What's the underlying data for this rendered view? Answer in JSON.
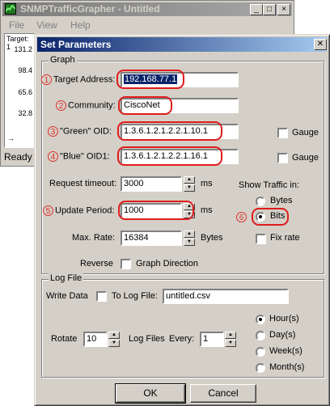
{
  "bg_window": {
    "title": "SNMPTrafficGrapher - Untitled",
    "menu": [
      "File",
      "View",
      "Help"
    ],
    "plot_header": "Target: 1",
    "plot_values": [
      "131.2",
      "98.4",
      "65.6",
      "32.8"
    ],
    "status": "Ready"
  },
  "dialog": {
    "title": "Set Parameters",
    "close_glyph": "✕",
    "graph_group": "Graph",
    "target_address_label": "Target Address:",
    "target_address": "192.168.77.1",
    "community_label": "Community:",
    "community": "CiscoNet",
    "green_oid_label": "\"Green\" OID:",
    "green_oid": "1.3.6.1.2.1.2.2.1.10.1",
    "blue_oid_label": "\"Blue\" OID1:",
    "blue_oid": "1.3.6.1.2.1.2.2.1.16.1",
    "gauge_label": "Gauge",
    "request_timeout_label": "Request timeout:",
    "request_timeout": "3000",
    "update_period_label": "Update Period:",
    "update_period": "1000",
    "max_rate_label": "Max. Rate:",
    "max_rate": "16384",
    "ms_unit": "ms",
    "bytes_unit": "Bytes",
    "show_traffic_label": "Show Traffic in:",
    "bytes_option": "Bytes",
    "bits_option": "Bits",
    "fix_rate_label": "Fix rate",
    "reverse_label": "Reverse",
    "graph_direction_label": "Graph Direction",
    "log_group": "Log File",
    "write_data_label": "Write Data",
    "to_log_file_label": "To Log File:",
    "log_file": "untitled.csv",
    "rotate_label": "Rotate",
    "rotate_value": "10",
    "log_files_label": "Log Files",
    "every_label": "Every:",
    "every_value": "1",
    "period_options": [
      "Hour(s)",
      "Day(s)",
      "Week(s)",
      "Month(s)"
    ],
    "ok_label": "OK",
    "cancel_label": "Cancel",
    "markers": [
      "1",
      "2",
      "3",
      "4",
      "5",
      "6"
    ]
  },
  "colors": {
    "annotation": "#e01c1c",
    "titlebar": "#0a246a",
    "face": "#d4d0c8"
  }
}
